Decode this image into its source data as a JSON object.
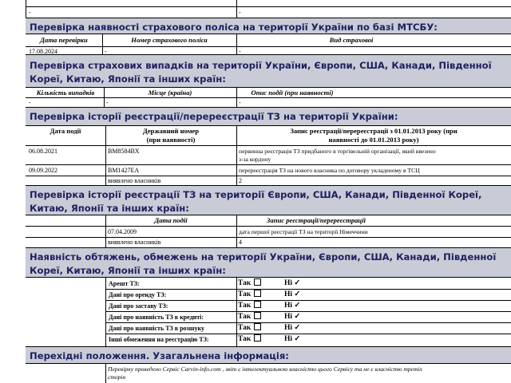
{
  "top_row": {
    "c1": "-",
    "c2": "-"
  },
  "mtsbu": {
    "title": "Перевірка наявності страхового поліса на території України по базі МТСБУ:",
    "headers": [
      "Дата перевірки",
      "Номер страхового поліса",
      "Вид страховоі"
    ],
    "row": [
      "17.08.2024",
      "-",
      "-"
    ]
  },
  "insurance_cases": {
    "title": "Перевірка страхових випадків на території України, Європи, США, Канади, Південної Кореї, Китаю, Японії та інших країн:",
    "headers": [
      "Кількість випадків",
      "Місце (країна)",
      "Опис події (при наявності)"
    ],
    "row": [
      "-",
      "-",
      "-"
    ]
  },
  "reg_ua": {
    "title": "Перевірка історії реєстрації/перереєстрації ТЗ на території України:",
    "headers": [
      "Дата події",
      "Державний номер",
      "(при наявності)",
      "Запис реєстрації/перереєстрації з 01.01.2013 року (при",
      "наявності до 01.01.2013 року)"
    ],
    "rows": [
      {
        "date": "06.08.2021",
        "plate": "BM8584BX",
        "note1": "первинна реєстрація ТЗ придбаного в торгівельній організації, який ввезено",
        "note2": "з-за кордону"
      },
      {
        "date": "09.09.2022",
        "plate": "BM1427EA",
        "note1": "перереєстрація ТЗ на нового власника по договору укладеному в ТСЦ",
        "note2": ""
      }
    ],
    "owners_label": "виявлено власників",
    "owners_value": "2"
  },
  "reg_foreign": {
    "title": "Перевірка історії реєстрації ТЗ на території Європи, США, Канади, Південної Кореї, Китаю, Японії та інших країн:",
    "headers": [
      "Дата події",
      "Запис реєстрації/перереєстрації"
    ],
    "row": {
      "date": "07.04.2009",
      "note": "дата першої реєстрації ТЗ на території Німеччини"
    },
    "owners_label": "виявлено власників",
    "owners_value": "4"
  },
  "encumbrances": {
    "title": "Наявність обтяжень, обмежень на території України, Європи, США, Канади, Південної Кореї, Китаю, Японії та інших країн:",
    "yes_label": "Так",
    "no_label": "Ні ✓",
    "items": [
      "Арешт ТЗ:",
      "Дані про оренду ТЗ:",
      "Дані про заставу ТЗ:",
      "Дані про наявність ТЗ в кредиті:",
      "Дані про наявність ТЗ в розшуку",
      "Інші обмеження на реєстрацію ТЗ:"
    ]
  },
  "transitional": {
    "title": "Перехідні положення. Узагальнена інформація:",
    "note1": "Перевірку проведено Сервіс Carvin-info.com , звіт є інтелектуальною власністю цього Сервісу та не є власністю третіх",
    "note2": "сторін"
  }
}
